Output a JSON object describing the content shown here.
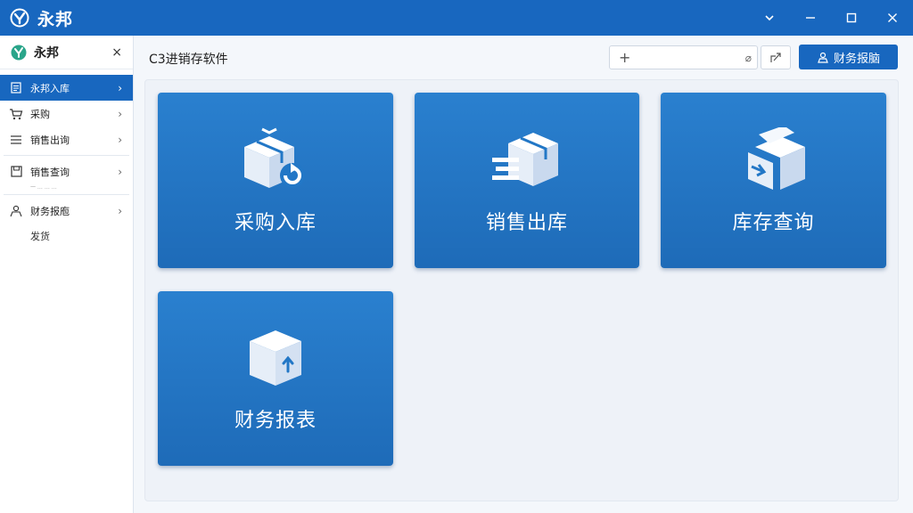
{
  "app": {
    "title": "永邦"
  },
  "window_controls": {
    "dropdown": "⌄",
    "minimize": "—",
    "maximize": "☐",
    "close": "✕"
  },
  "sidebar": {
    "header": {
      "title": "永邦",
      "close": "×"
    },
    "items": [
      {
        "label": "永邦入库",
        "icon": "list-icon",
        "chevron": "›",
        "active": true
      },
      {
        "label": "采购",
        "icon": "cart-icon",
        "chevron": "›"
      },
      {
        "label": "销售出询",
        "icon": "menu-icon",
        "chevron": "›"
      },
      {
        "label": "销售查询",
        "icon": "save-icon",
        "chevron": "›"
      },
      {
        "label": "财务报庖",
        "icon": "people-icon",
        "chevron": "›"
      }
    ],
    "faint_text": "一 … … …",
    "sub_item": "发货"
  },
  "main": {
    "page_title": "C3进销存软件",
    "search": {
      "plus": "+",
      "clear": "⌀"
    },
    "report_button": "财务报脑"
  },
  "tiles": [
    {
      "label": "采购入库",
      "icon": "box-return-icon"
    },
    {
      "label": "销售出库",
      "icon": "box-speed-icon"
    },
    {
      "label": "库存查询",
      "icon": "box-arrow-icon"
    },
    {
      "label": "财务报表",
      "icon": "box-upload-icon"
    }
  ],
  "colors": {
    "accent": "#1867bf",
    "tile": "#2277c6",
    "background": "#f4f7fb"
  }
}
